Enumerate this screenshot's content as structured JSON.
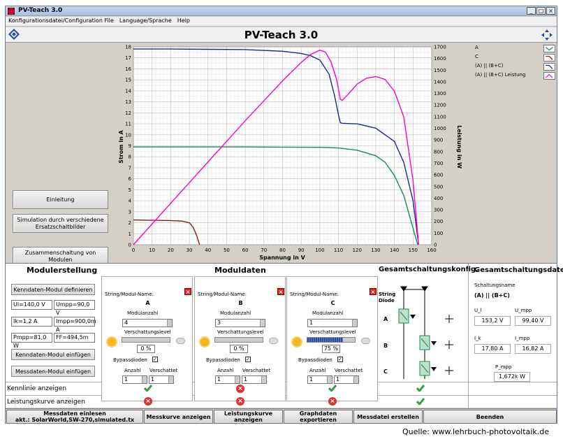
{
  "window": {
    "title": "PV-Teach 3.0"
  },
  "menu": [
    "Konfigurationsdatei/Configuration File",
    "Language/Sprache",
    "Help"
  ],
  "app_title": "PV-Teach 3.0",
  "left_buttons": [
    "Einleitung",
    "Simulation durch verschiedene Ersatzschaltbilder",
    "Zusammenschaltung von Modulen"
  ],
  "chart_data": {
    "type": "line",
    "xlabel": "Spannung in V",
    "ylabel": "Strom in A",
    "y2label": "Leistung in W",
    "xlim": [
      0,
      160
    ],
    "ylim": [
      0,
      18
    ],
    "y2lim": [
      0,
      1700
    ],
    "x_ticks": [
      0,
      10,
      20,
      30,
      40,
      50,
      60,
      70,
      80,
      90,
      100,
      110,
      120,
      130,
      140,
      150,
      160
    ],
    "y_ticks": [
      0,
      1,
      2,
      3,
      4,
      5,
      6,
      7,
      8,
      9,
      10,
      11,
      12,
      13,
      14,
      15,
      16,
      17,
      18
    ],
    "y2_ticks": [
      0,
      100,
      200,
      300,
      400,
      500,
      600,
      700,
      800,
      900,
      1000,
      1100,
      1200,
      1300,
      1400,
      1500,
      1600,
      1700
    ],
    "grid": true,
    "legend_position": "top-right",
    "series": [
      {
        "name": "A",
        "color": "#1a8a5a",
        "axis": "y",
        "x": [
          0,
          20,
          40,
          60,
          80,
          100,
          110,
          120,
          130,
          135,
          140,
          145,
          150,
          152.5
        ],
        "y": [
          8.9,
          8.9,
          8.9,
          8.9,
          8.88,
          8.86,
          8.8,
          8.6,
          8.1,
          7.5,
          6.3,
          4.5,
          1.5,
          0
        ]
      },
      {
        "name": "C",
        "color": "#8a1a1a",
        "axis": "y",
        "x": [
          0,
          10,
          20,
          26,
          30,
          32,
          34,
          35.5
        ],
        "y": [
          2.25,
          2.22,
          2.2,
          2.15,
          2.0,
          1.6,
          0.8,
          0
        ]
      },
      {
        "name": "(A) || (B+C)",
        "color": "#1a2a8a",
        "axis": "y",
        "x": [
          0,
          20,
          40,
          60,
          80,
          90,
          95,
          100,
          105,
          108,
          110,
          111,
          112,
          120,
          130,
          140,
          145,
          150,
          153
        ],
        "y": [
          17.8,
          17.8,
          17.78,
          17.75,
          17.6,
          17.4,
          17.2,
          16.8,
          15.5,
          13.5,
          11.8,
          11.1,
          11.05,
          11.0,
          10.6,
          9.4,
          7.5,
          4.0,
          0
        ]
      },
      {
        "name": "(A) || (B+C)  Leistung",
        "color": "#ff00cc",
        "axis": "y2",
        "x": [
          0,
          20,
          40,
          60,
          80,
          90,
          95,
          100,
          103,
          106,
          109,
          111,
          112,
          115,
          120,
          125,
          130,
          135,
          140,
          145,
          150,
          153
        ],
        "y": [
          0,
          356,
          711,
          1065,
          1408,
          1566,
          1634,
          1672,
          1655,
          1570,
          1420,
          1250,
          1240,
          1290,
          1380,
          1430,
          1445,
          1420,
          1320,
          1100,
          550,
          0
        ]
      }
    ]
  },
  "legend": [
    "A",
    "C",
    "(A) || (B+C)",
    "(A) || (B+C)  Leistung"
  ],
  "modulerstellung": {
    "title": "Modulerstellung",
    "define_btn": "Kenndaten-Modul definieren",
    "fields": [
      "Ul=140,0 V",
      "Umpp=90,0 V",
      "Ik=1,2 A",
      "Impp=900,0m A",
      "Pmpp=81,0 W",
      "FF=494,5m"
    ],
    "insert_btn": "Kenndaten-Modul einfügen",
    "measure_btn": "Messdaten-Modul einfügen"
  },
  "moduldaten": {
    "title": "Moduldaten",
    "name_label": "String/Modul-Name:",
    "count_label": "Modulanzahl",
    "shade_label": "Verschattungslevel",
    "bypass_label": "Bypassdioden",
    "anzahl_label": "Anzahl",
    "verschattet_label": "Verschattet",
    "panels": [
      {
        "name": "A",
        "count": "4",
        "shade": "0 %",
        "shade_frac": 0,
        "anzahl": "1",
        "verschattet": "1"
      },
      {
        "name": "B",
        "count": "3",
        "shade": "0 %",
        "shade_frac": 0,
        "anzahl": "1",
        "verschattet": "1"
      },
      {
        "name": "C",
        "count": "1",
        "shade": "75 %",
        "shade_frac": 0.75,
        "anzahl": "1",
        "verschattet": "1"
      }
    ]
  },
  "status": {
    "kennlinie": "Kennlinie anzeigen",
    "leistung": "Leistungskurve anzeigen"
  },
  "gesamtkonfig": {
    "title": "Gesamtschaltungskonfig.",
    "string_diode": "String Diode",
    "rows": [
      "A",
      "B",
      "C"
    ]
  },
  "gesamtdaten": {
    "title": "Gesamtschaltungsdaten",
    "name_label": "Schaltungsname",
    "name": "(A) || (B+C)",
    "U_l_label": "U_l",
    "U_l": "153,2 V",
    "U_mpp_label": "U_mpp",
    "U_mpp": "99,40 V",
    "I_k_label": "I_k",
    "I_k": "17,80 A",
    "I_mpp_label": "I_mpp",
    "I_mpp": "16,82 A",
    "P_mpp_label": "P_mpp",
    "P_mpp": "1,672k W"
  },
  "footer": {
    "b1a": "Messdaten einlesen",
    "b1b": "akt.: SolarWorld,SW-270,simulated.tx",
    "b2": "Messkurve anzeigen",
    "b3": "Leistungskurve anzeigen",
    "b4": "Graphdaten exportieren",
    "b5": "Messdatei erstellen",
    "b6": "Beenden"
  },
  "source": "Quelle: www.lehrbuch-photovoltaik.de"
}
